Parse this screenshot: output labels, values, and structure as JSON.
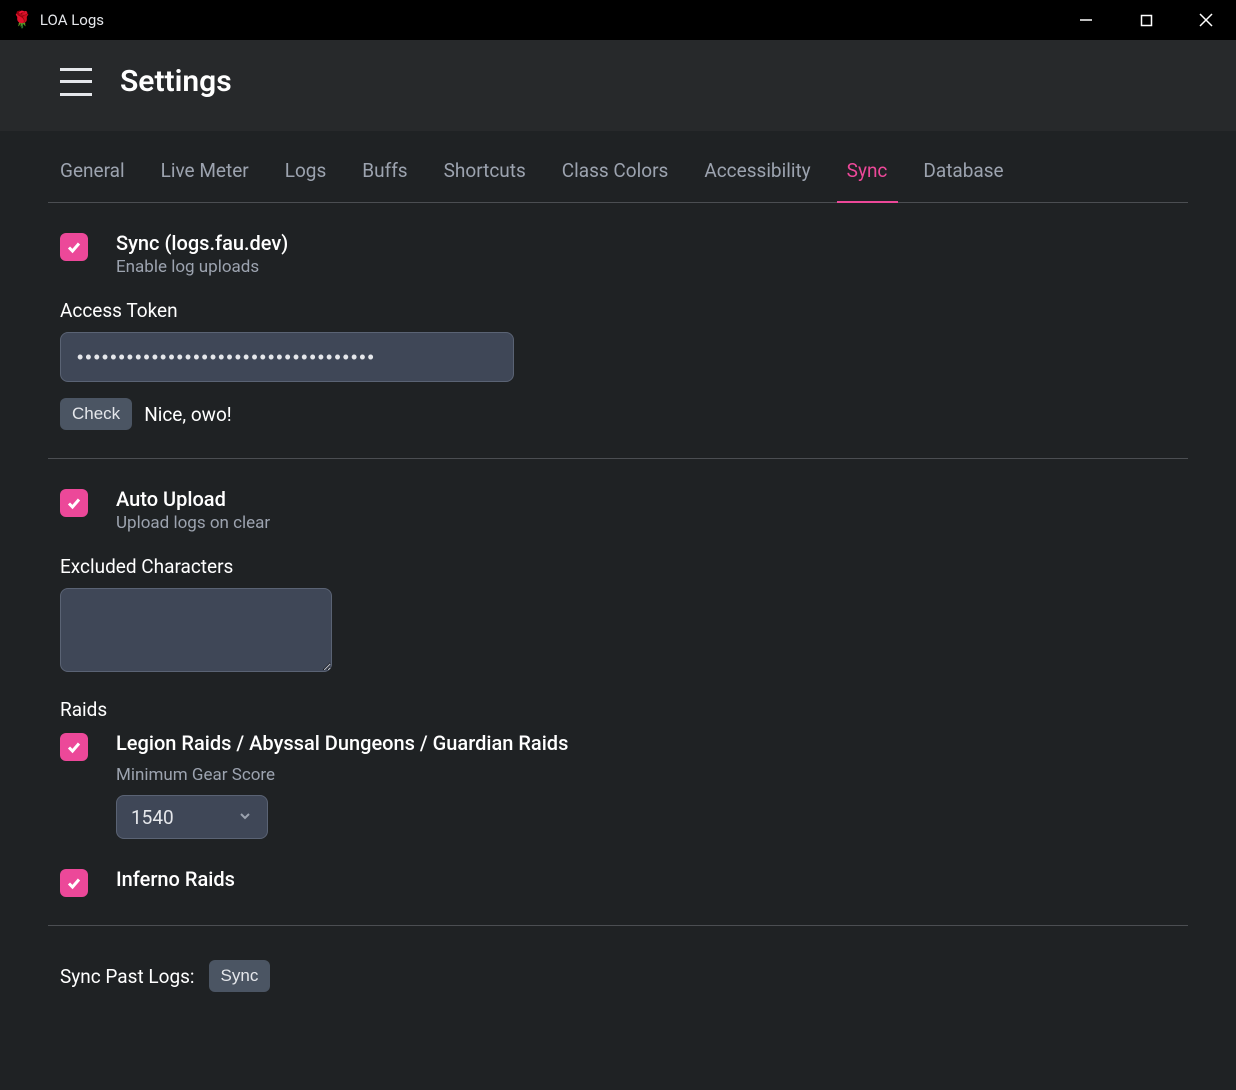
{
  "window": {
    "title": "LOA Logs"
  },
  "header": {
    "title": "Settings"
  },
  "tabs": [
    {
      "label": "General",
      "active": false
    },
    {
      "label": "Live Meter",
      "active": false
    },
    {
      "label": "Logs",
      "active": false
    },
    {
      "label": "Buffs",
      "active": false
    },
    {
      "label": "Shortcuts",
      "active": false
    },
    {
      "label": "Class Colors",
      "active": false
    },
    {
      "label": "Accessibility",
      "active": false
    },
    {
      "label": "Sync",
      "active": true
    },
    {
      "label": "Database",
      "active": false
    }
  ],
  "sync": {
    "enable": {
      "title": "Sync (logs.fau.dev)",
      "sub": "Enable log uploads",
      "checked": true
    },
    "token_label": "Access Token",
    "token_value": "••••••••••••••••••••••••••••••••••••",
    "check_button": "Check",
    "check_result": "Nice, owo!"
  },
  "auto_upload": {
    "title": "Auto Upload",
    "sub": "Upload logs on clear",
    "checked": true,
    "excluded_label": "Excluded Characters",
    "excluded_value": ""
  },
  "raids": {
    "label": "Raids",
    "legion": {
      "title": "Legion Raids / Abyssal Dungeons / Guardian Raids",
      "checked": true,
      "gear_label": "Minimum Gear Score",
      "gear_value": "1540"
    },
    "inferno": {
      "title": "Inferno Raids",
      "checked": true
    }
  },
  "past_logs": {
    "label": "Sync Past Logs:",
    "button": "Sync"
  }
}
